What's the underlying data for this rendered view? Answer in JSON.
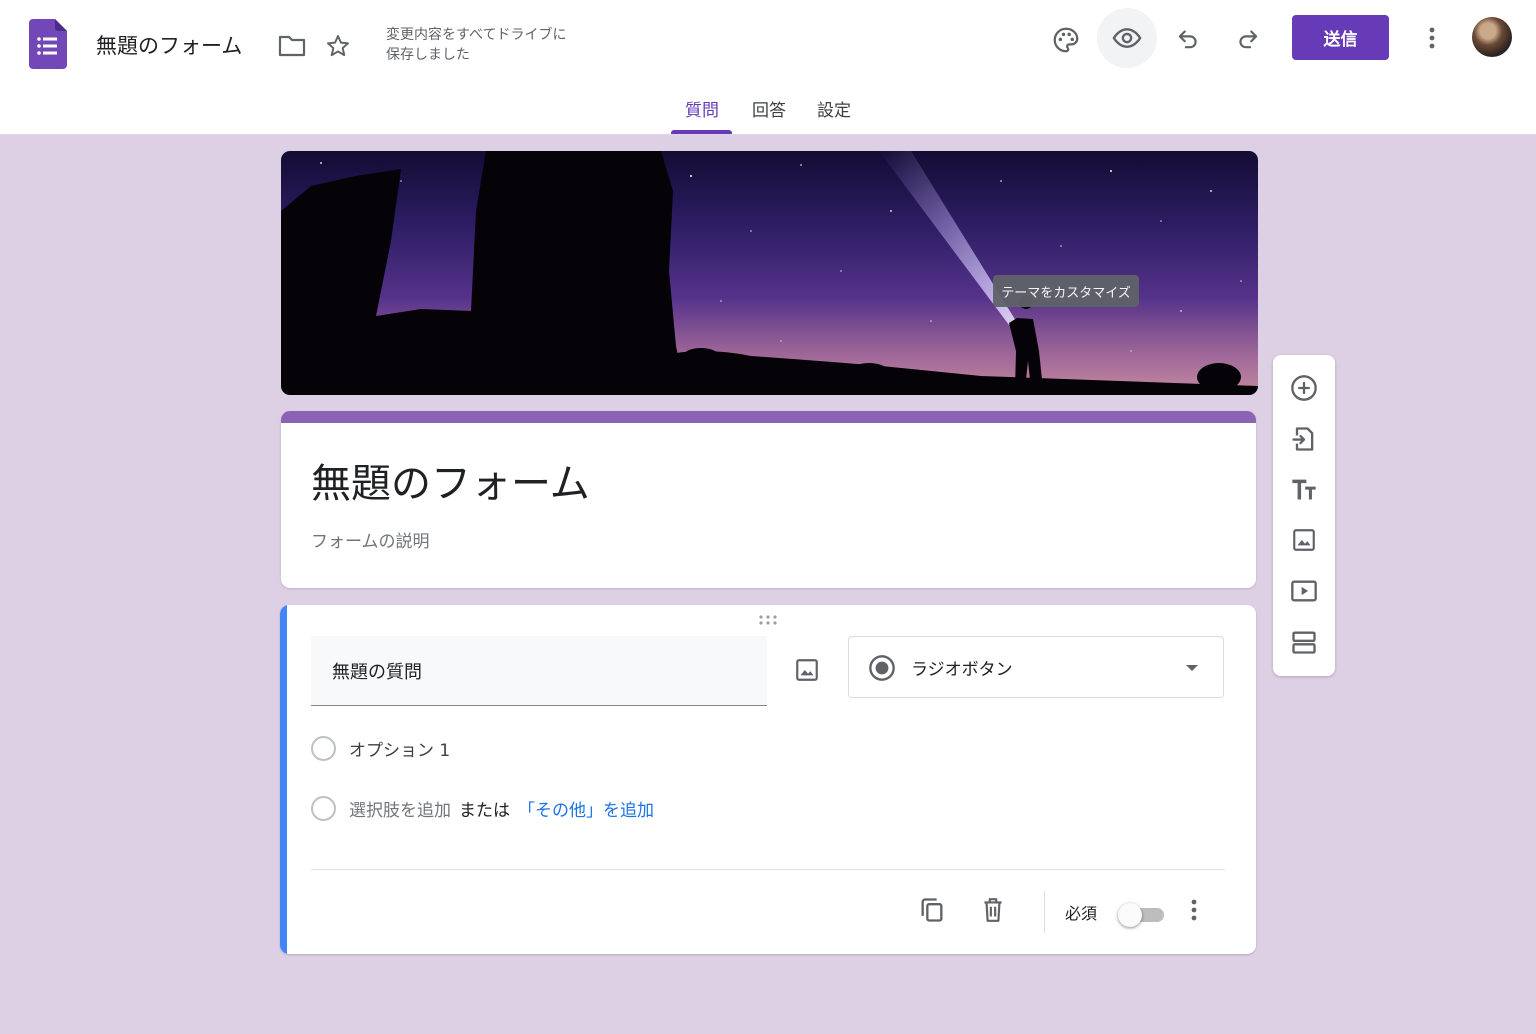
{
  "header": {
    "title": "無題のフォーム",
    "save_status_line1": "変更内容をすべてドライブに",
    "save_status_line2": "保存しました",
    "send_label": "送信",
    "icons": [
      "forms-logo-icon",
      "folder-icon",
      "star-icon",
      "palette-icon",
      "eye-icon",
      "undo-icon",
      "redo-icon",
      "more-vert-icon",
      "avatar"
    ]
  },
  "tabs": [
    {
      "label": "質問",
      "active": true
    },
    {
      "label": "回答",
      "active": false
    },
    {
      "label": "設定",
      "active": false
    }
  ],
  "banner": {
    "tooltip": "テーマをカスタマイズ"
  },
  "form": {
    "title": "無題のフォーム",
    "description_placeholder": "フォームの説明"
  },
  "question": {
    "title": "無題の質問",
    "type": "ラジオボタン",
    "options": [
      "オプション 1"
    ],
    "add_option": "選択肢を追加",
    "or_text": "または",
    "add_other": "「その他」を追加",
    "required_label": "必須",
    "required": false
  },
  "side_toolbar": [
    "add-question-icon",
    "import-questions-icon",
    "add-title-icon",
    "add-image-icon",
    "add-video-icon",
    "add-section-icon"
  ],
  "colors": {
    "accent": "#673ab7",
    "background": "#ddd0e5",
    "question_bar": "#4285f4",
    "title_bar": "#8c63b3",
    "link": "#1a73e8"
  }
}
